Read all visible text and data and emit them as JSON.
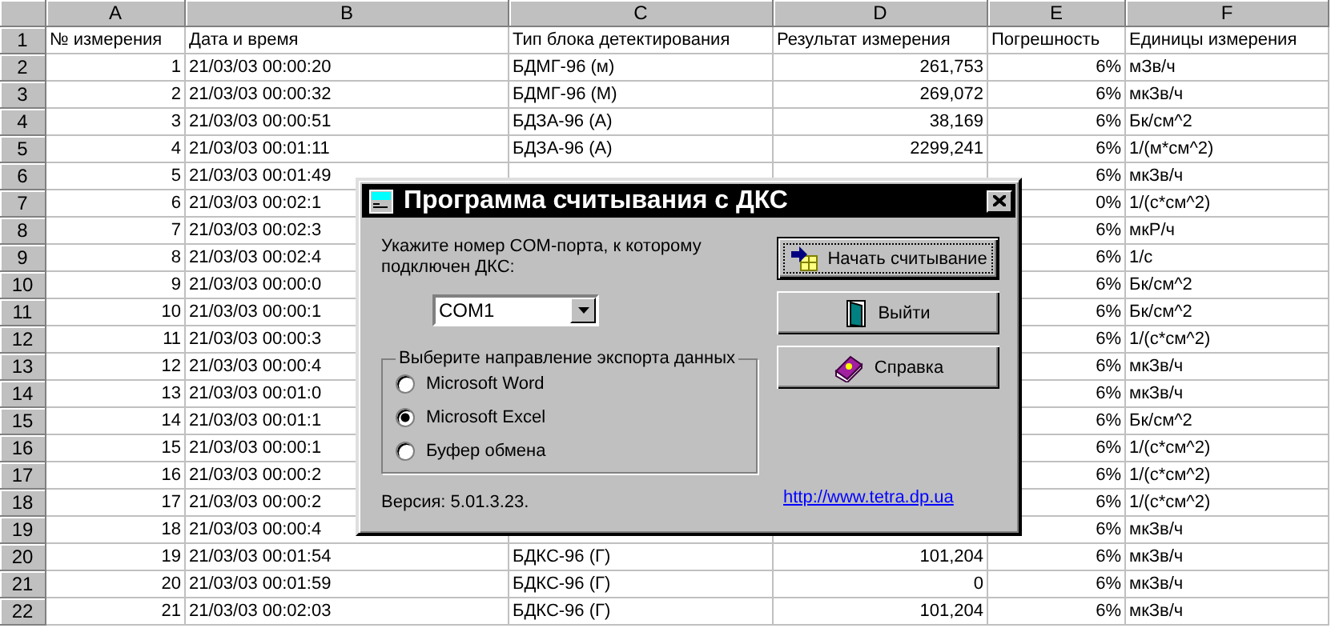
{
  "sheet": {
    "column_headers": [
      "A",
      "B",
      "C",
      "D",
      "E",
      "F"
    ],
    "rows": [
      {
        "number": "1",
        "kind": "header",
        "cells": {
          "A": "№ измерения",
          "B": "Дата и время",
          "C": "Тип блока детектирования",
          "D": "Результат измерения",
          "E": "Погрешность",
          "F": "Единицы измерения"
        }
      },
      {
        "number": "2",
        "kind": "data",
        "cells": {
          "A": "1",
          "B": "21/03/03 00:00:20",
          "C": "БДМГ-96 (м)",
          "D": "261,753",
          "E": "6%",
          "F": "мЗв/ч"
        }
      },
      {
        "number": "3",
        "kind": "data",
        "cells": {
          "A": "2",
          "B": "21/03/03 00:00:32",
          "C": "БДМГ-96 (М)",
          "D": "269,072",
          "E": "6%",
          "F": "мкЗв/ч"
        }
      },
      {
        "number": "4",
        "kind": "data",
        "cells": {
          "A": "3",
          "B": "21/03/03 00:00:51",
          "C": "БДЗА-96 (А)",
          "D": "38,169",
          "E": "6%",
          "F": "Бк/см^2"
        }
      },
      {
        "number": "5",
        "kind": "data",
        "cells": {
          "A": "4",
          "B": "21/03/03 00:01:11",
          "C": "БДЗА-96 (А)",
          "D": "2299,241",
          "E": "6%",
          "F": "1/(м*см^2)"
        }
      },
      {
        "number": "6",
        "kind": "data",
        "cells": {
          "A": "5",
          "B": "21/03/03 00:01:49",
          "E": "6%",
          "F": "мкЗв/ч"
        }
      },
      {
        "number": "7",
        "kind": "data",
        "cells": {
          "A": "6",
          "B": "21/03/03 00:02:1",
          "E": "0%",
          "F": "1/(с*см^2)"
        }
      },
      {
        "number": "8",
        "kind": "data",
        "cells": {
          "A": "7",
          "B": "21/03/03 00:02:3",
          "E": "6%",
          "F": "мкР/ч"
        }
      },
      {
        "number": "9",
        "kind": "data",
        "cells": {
          "A": "8",
          "B": "21/03/03 00:02:4",
          "E": "6%",
          "F": "1/с"
        }
      },
      {
        "number": "10",
        "kind": "data",
        "cells": {
          "A": "9",
          "B": "21/03/03 00:00:0",
          "E": "6%",
          "F": "Бк/см^2"
        }
      },
      {
        "number": "11",
        "kind": "data",
        "cells": {
          "A": "10",
          "B": "21/03/03 00:00:1",
          "E": "6%",
          "F": "Бк/см^2"
        }
      },
      {
        "number": "12",
        "kind": "data",
        "cells": {
          "A": "11",
          "B": "21/03/03 00:00:3",
          "E": "6%",
          "F": "1/(с*см^2)"
        }
      },
      {
        "number": "13",
        "kind": "data",
        "cells": {
          "A": "12",
          "B": "21/03/03 00:00:4",
          "E": "6%",
          "F": "мкЗв/ч"
        }
      },
      {
        "number": "14",
        "kind": "data",
        "cells": {
          "A": "13",
          "B": "21/03/03 00:01:0",
          "E": "6%",
          "F": "мкЗв/ч"
        }
      },
      {
        "number": "15",
        "kind": "data",
        "cells": {
          "A": "14",
          "B": "21/03/03 00:01:1",
          "E": "6%",
          "F": "Бк/см^2"
        }
      },
      {
        "number": "16",
        "kind": "data",
        "cells": {
          "A": "15",
          "B": "21/03/03 00:00:1",
          "E": "6%",
          "F": "1/(с*см^2)"
        }
      },
      {
        "number": "17",
        "kind": "data",
        "cells": {
          "A": "16",
          "B": "21/03/03 00:00:2",
          "E": "6%",
          "F": "1/(с*см^2)"
        }
      },
      {
        "number": "18",
        "kind": "data",
        "cells": {
          "A": "17",
          "B": "21/03/03 00:00:2",
          "E": "6%",
          "F": "1/(с*см^2)"
        }
      },
      {
        "number": "19",
        "kind": "data",
        "cells": {
          "A": "18",
          "B": "21/03/03 00:00:4",
          "E": "6%",
          "F": "мкЗв/ч"
        }
      },
      {
        "number": "20",
        "kind": "data",
        "cells": {
          "A": "19",
          "B": "21/03/03 00:01:54",
          "C": "БДКС-96 (Г)",
          "D": "101,204",
          "E": "6%",
          "F": "мкЗв/ч"
        }
      },
      {
        "number": "21",
        "kind": "data",
        "cells": {
          "A": "20",
          "B": "21/03/03 00:01:59",
          "C": "БДКС-96 (Г)",
          "D": "0",
          "E": "6%",
          "F": "мкЗв/ч"
        }
      },
      {
        "number": "22",
        "kind": "data",
        "cells": {
          "A": "21",
          "B": "21/03/03 00:02:03",
          "C": "БДКС-96 (Г)",
          "D": "101,204",
          "E": "6%",
          "F": "мкЗв/ч"
        }
      }
    ]
  },
  "dialog": {
    "title": "Программа считывания с ДКС",
    "port_prompt": "Укажите номер COM-порта, к которому подключен ДКС:",
    "port_value": "COM1",
    "export_group": {
      "legend": "Выберите направление экспорта данных",
      "options": [
        {
          "label": "Microsoft Word",
          "selected": false
        },
        {
          "label": "Microsoft Excel",
          "selected": true
        },
        {
          "label": "Буфер обмена",
          "selected": false
        }
      ]
    },
    "buttons": [
      {
        "kind": "start",
        "label": "Начать считывание",
        "default": true
      },
      {
        "kind": "exit",
        "label": "Выйти",
        "default": false
      },
      {
        "kind": "help",
        "label": "Справка",
        "default": false
      }
    ],
    "version": "Версия: 5.01.3.23.",
    "link": "http://www.tetra.dp.ua"
  }
}
